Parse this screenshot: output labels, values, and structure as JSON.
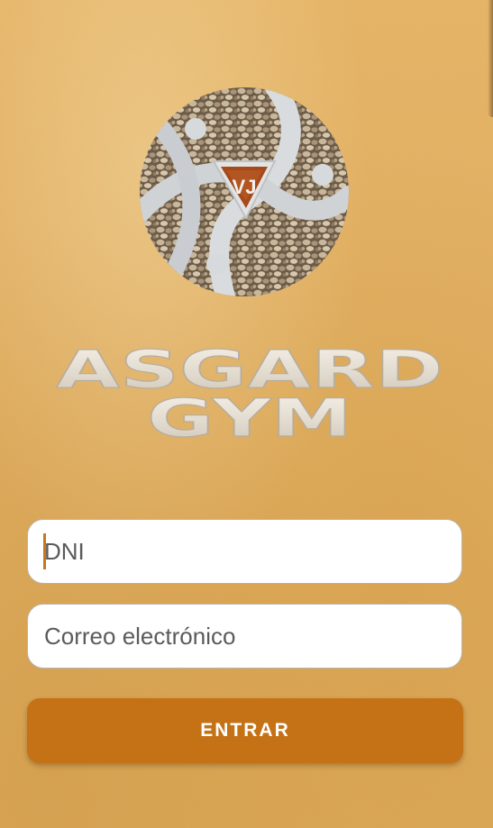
{
  "app": {
    "brand_line1": "ASGARD",
    "brand_line2": "GYM",
    "logo_monogram": "VJ"
  },
  "form": {
    "dni_placeholder": "DNI",
    "email_placeholder": "Correo electrónico",
    "submit_label": "ENTRAR"
  },
  "colors": {
    "background": "#e3b063",
    "accent": "#c57217",
    "field_border": "#b9b3ab",
    "caret": "#c8781a"
  }
}
